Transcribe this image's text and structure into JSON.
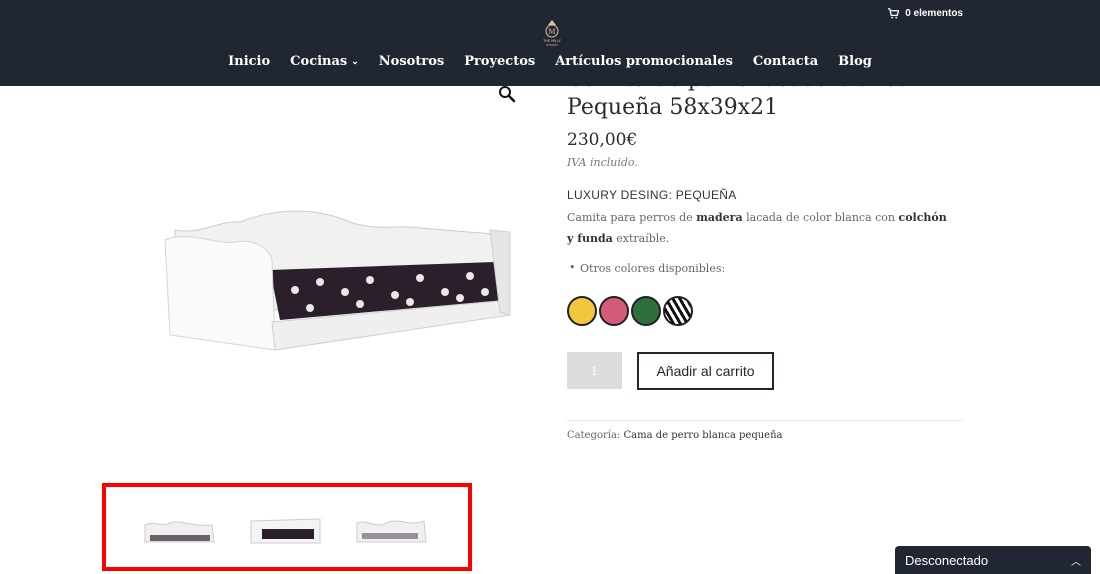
{
  "header": {
    "cart_text": "0 elementos",
    "logo_text": "THE MILLY STUDIO",
    "nav": [
      {
        "label": "Inicio"
      },
      {
        "label": "Cocinas"
      },
      {
        "label": "Nosotros"
      },
      {
        "label": "Proyectos"
      },
      {
        "label": "Artículos promocionales"
      },
      {
        "label": "Contacta"
      },
      {
        "label": "Blog"
      }
    ]
  },
  "product": {
    "title_line1": "Camita de perro lacada blanca",
    "title_line2": "Pequeña 58x39x21",
    "price": "230,00€",
    "tax_note": "IVA incluido.",
    "subheading": "LUXURY DESING: PEQUEÑA",
    "desc_1": "Camita para perros de ",
    "desc_2": "madera",
    "desc_3": " lacada de color blanca con ",
    "desc_4": "colchón y funda",
    "desc_5": " extraíble.",
    "bullet": "Otros colores disponibles:",
    "swatch_colors": [
      "#f4c63d",
      "#d45c7a",
      "#2e6f3c",
      "zebra"
    ],
    "quantity": "1",
    "add_to_cart": "Añadir al carrito",
    "category_label": "Categoría:",
    "category_link": "Cama de perro blanca pequeña"
  },
  "chat": {
    "label": "Desconectado"
  },
  "colors": {
    "header_bg": "#202733",
    "highlight": "#ff0000"
  }
}
